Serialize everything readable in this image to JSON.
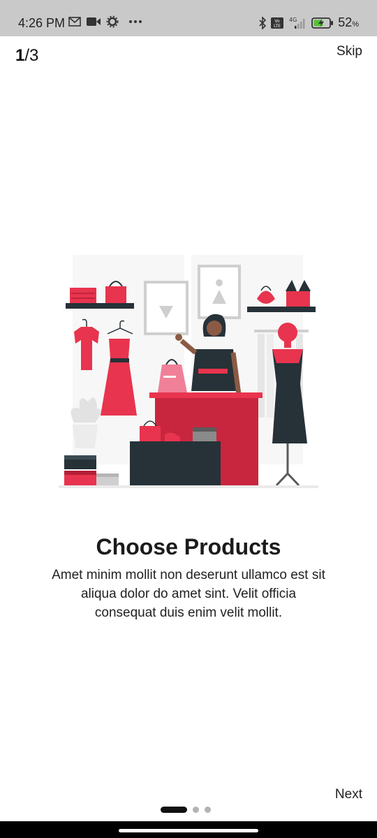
{
  "status": {
    "time": "4:26 PM",
    "battery_percent": "52",
    "battery_unit": "%",
    "network": "4G",
    "icons": [
      "gmail-icon",
      "video-icon",
      "settings-icon",
      "more-icon",
      "bluetooth-icon",
      "volte-icon",
      "signal-icon",
      "battery-charging-icon"
    ]
  },
  "onboarding": {
    "current_page": "1",
    "page_separator": "/3",
    "skip_label": "Skip",
    "title": "Choose Products",
    "description": "Amet minim mollit non deserunt ullamco est sit aliqua dolor do amet sint. Velit officia consequat duis enim velit mollit.",
    "next_label": "Next",
    "total_pages": 3,
    "active_index": 0
  },
  "colors": {
    "accent": "#e8344e",
    "dark": "#263238",
    "background": "#ffffff"
  }
}
